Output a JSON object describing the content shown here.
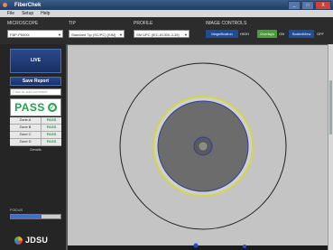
{
  "app": {
    "title": "FiberChek"
  },
  "window_buttons": {
    "minimize": "_",
    "maximize": "□",
    "close": "X"
  },
  "menu": {
    "items": [
      "File",
      "Setup",
      "Help"
    ]
  },
  "controls": {
    "microscope": {
      "label": "MICROSCOPE",
      "value": "FBP-P5000i"
    },
    "tip": {
      "label": "TIP",
      "value": "Standard Tip (SC/PC) [SIM]"
    },
    "profile": {
      "label": "PROFILE",
      "value": "SM UPC (IEC-61300-3-35)"
    },
    "image_controls": {
      "label": "IMAGE CONTROLS",
      "magnification": {
        "label": "Magnification",
        "value": "HIGH"
      },
      "overlays": {
        "label": "Overlays",
        "value": "ON"
      },
      "scaled_view": {
        "label": "ScaledView",
        "value": "OFF"
      }
    }
  },
  "sidebar": {
    "live_label": "LIVE",
    "save_report_label": "Save Report",
    "comment_placeholder": "Click to add comment",
    "result": "PASS",
    "zones": [
      {
        "name": "Zone A",
        "result": "PASS"
      },
      {
        "name": "Zone B",
        "result": "PASS"
      },
      {
        "name": "Zone C",
        "result": "PASS"
      },
      {
        "name": "Zone D",
        "result": "PASS"
      }
    ],
    "details_label": "Details",
    "focus_label": "FOCUS",
    "focus_level": 0.62,
    "logo_text": "JDSU"
  },
  "colors": {
    "pass": "#1aa64a",
    "accent_blue": "#1f4c9a",
    "overlay_green": "#4a9e3a",
    "zone_a": "#2d3f9e",
    "zone_b": "#2d3f9e",
    "zone_c": "#d2d648",
    "zone_d": "#333333"
  }
}
